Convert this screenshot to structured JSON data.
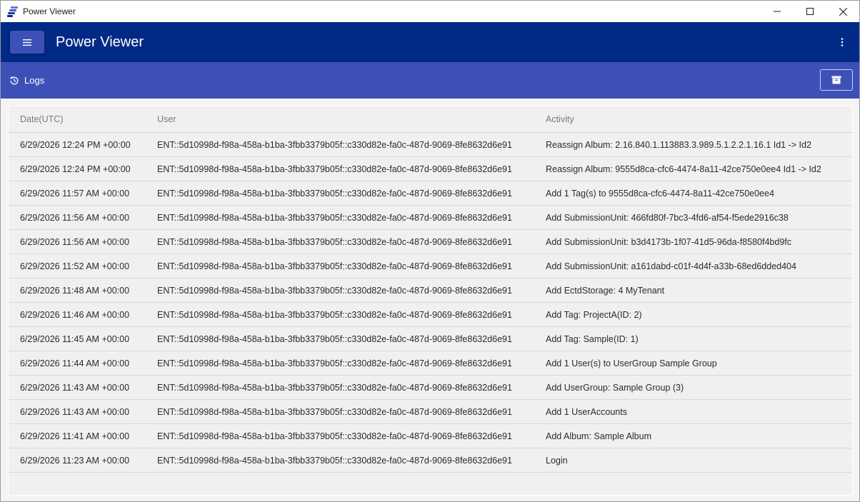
{
  "window": {
    "title": "Power Viewer"
  },
  "appbar": {
    "title": "Power Viewer"
  },
  "subbar": {
    "logs_label": "Logs"
  },
  "colors": {
    "appbar_bg": "#002a85",
    "subbar_bg": "#3d50b8",
    "menu_button_bg": "#3d50b8"
  },
  "icons": {
    "app": "power-viewer-logo-icon",
    "minimize": "minimize-icon",
    "maximize": "maximize-icon",
    "close": "close-icon",
    "menu": "hamburger-menu-icon",
    "more": "more-vertical-icon",
    "history": "history-icon",
    "archive": "archive-icon"
  },
  "table": {
    "headers": {
      "date": "Date(UTC)",
      "user": "User",
      "activity": "Activity"
    },
    "rows": [
      {
        "date": "6/29/2026 12:24 PM +00:00",
        "user": "ENT::5d10998d-f98a-458a-b1ba-3fbb3379b05f::c330d82e-fa0c-487d-9069-8fe8632d6e91",
        "activity": "Reassign Album: 2.16.840.1.113883.3.989.5.1.2.2.1.16.1 Id1 -> Id2"
      },
      {
        "date": "6/29/2026 12:24 PM +00:00",
        "user": "ENT::5d10998d-f98a-458a-b1ba-3fbb3379b05f::c330d82e-fa0c-487d-9069-8fe8632d6e91",
        "activity": "Reassign Album: 9555d8ca-cfc6-4474-8a11-42ce750e0ee4 Id1 -> Id2"
      },
      {
        "date": "6/29/2026 11:57 AM +00:00",
        "user": "ENT::5d10998d-f98a-458a-b1ba-3fbb3379b05f::c330d82e-fa0c-487d-9069-8fe8632d6e91",
        "activity": "Add 1 Tag(s) to 9555d8ca-cfc6-4474-8a11-42ce750e0ee4"
      },
      {
        "date": "6/29/2026 11:56 AM +00:00",
        "user": "ENT::5d10998d-f98a-458a-b1ba-3fbb3379b05f::c330d82e-fa0c-487d-9069-8fe8632d6e91",
        "activity": "Add SubmissionUnit: 466fd80f-7bc3-4fd6-af54-f5ede2916c38"
      },
      {
        "date": "6/29/2026 11:56 AM +00:00",
        "user": "ENT::5d10998d-f98a-458a-b1ba-3fbb3379b05f::c330d82e-fa0c-487d-9069-8fe8632d6e91",
        "activity": "Add SubmissionUnit: b3d4173b-1f07-41d5-96da-f8580f4bd9fc"
      },
      {
        "date": "6/29/2026 11:52 AM +00:00",
        "user": "ENT::5d10998d-f98a-458a-b1ba-3fbb3379b05f::c330d82e-fa0c-487d-9069-8fe8632d6e91",
        "activity": "Add SubmissionUnit: a161dabd-c01f-4d4f-a33b-68ed6dded404"
      },
      {
        "date": "6/29/2026 11:48 AM +00:00",
        "user": "ENT::5d10998d-f98a-458a-b1ba-3fbb3379b05f::c330d82e-fa0c-487d-9069-8fe8632d6e91",
        "activity": "Add EctdStorage: 4 MyTenant"
      },
      {
        "date": "6/29/2026 11:46 AM +00:00",
        "user": "ENT::5d10998d-f98a-458a-b1ba-3fbb3379b05f::c330d82e-fa0c-487d-9069-8fe8632d6e91",
        "activity": "Add Tag: ProjectA(ID: 2)"
      },
      {
        "date": "6/29/2026 11:45 AM +00:00",
        "user": "ENT::5d10998d-f98a-458a-b1ba-3fbb3379b05f::c330d82e-fa0c-487d-9069-8fe8632d6e91",
        "activity": "Add Tag: Sample(ID: 1)"
      },
      {
        "date": "6/29/2026 11:44 AM +00:00",
        "user": "ENT::5d10998d-f98a-458a-b1ba-3fbb3379b05f::c330d82e-fa0c-487d-9069-8fe8632d6e91",
        "activity": "Add 1 User(s) to UserGroup Sample Group"
      },
      {
        "date": "6/29/2026 11:43 AM +00:00",
        "user": "ENT::5d10998d-f98a-458a-b1ba-3fbb3379b05f::c330d82e-fa0c-487d-9069-8fe8632d6e91",
        "activity": "Add UserGroup: Sample Group (3)"
      },
      {
        "date": "6/29/2026 11:43 AM +00:00",
        "user": "ENT::5d10998d-f98a-458a-b1ba-3fbb3379b05f::c330d82e-fa0c-487d-9069-8fe8632d6e91",
        "activity": "Add 1 UserAccounts"
      },
      {
        "date": "6/29/2026 11:41 AM +00:00",
        "user": "ENT::5d10998d-f98a-458a-b1ba-3fbb3379b05f::c330d82e-fa0c-487d-9069-8fe8632d6e91",
        "activity": "Add Album: Sample Album"
      },
      {
        "date": "6/29/2026 11:23 AM +00:00",
        "user": "ENT::5d10998d-f98a-458a-b1ba-3fbb3379b05f::c330d82e-fa0c-487d-9069-8fe8632d6e91",
        "activity": "Login"
      }
    ]
  }
}
